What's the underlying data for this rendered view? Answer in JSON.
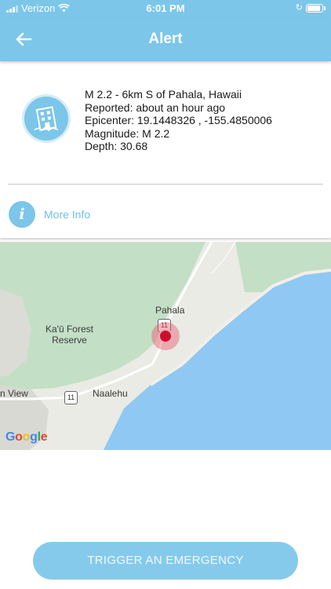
{
  "status_bar": {
    "carrier": "Verizon",
    "time": "6:01 PM",
    "icons": [
      "signal-icon",
      "wifi-icon",
      "charging-icon",
      "battery-icon"
    ]
  },
  "nav": {
    "title": "Alert",
    "back_icon": "back-arrow-icon"
  },
  "alert": {
    "icon": "earthquake-building-icon",
    "title": "M 2.2 - 6km S of Pahala, Hawaii",
    "reported": "Reported: about an hour ago",
    "epicenter": "Epicenter: 19.1448326 , -155.4850006",
    "magnitude": "Magnitude: M 2.2",
    "depth": "Depth: 30.68"
  },
  "more_info": {
    "icon": "info-icon",
    "label": "More Info"
  },
  "map": {
    "labels": {
      "town": "Pahala",
      "forest_line1": "Ka'ū Forest",
      "forest_line2": "Reserve",
      "view": "n View",
      "naalehu": "Naalehu",
      "route_a": "11",
      "route_b": "11"
    },
    "attribution": "Google",
    "colors": {
      "land": "#e9ebe4",
      "forest": "#c3dfc6",
      "water": "#8fc8f2",
      "marker": "#c8102e"
    }
  },
  "action": {
    "label": "TRIGGER AN EMERGENCY"
  },
  "colors": {
    "accent": "#7cc6ea",
    "link": "#6fbfe4"
  }
}
